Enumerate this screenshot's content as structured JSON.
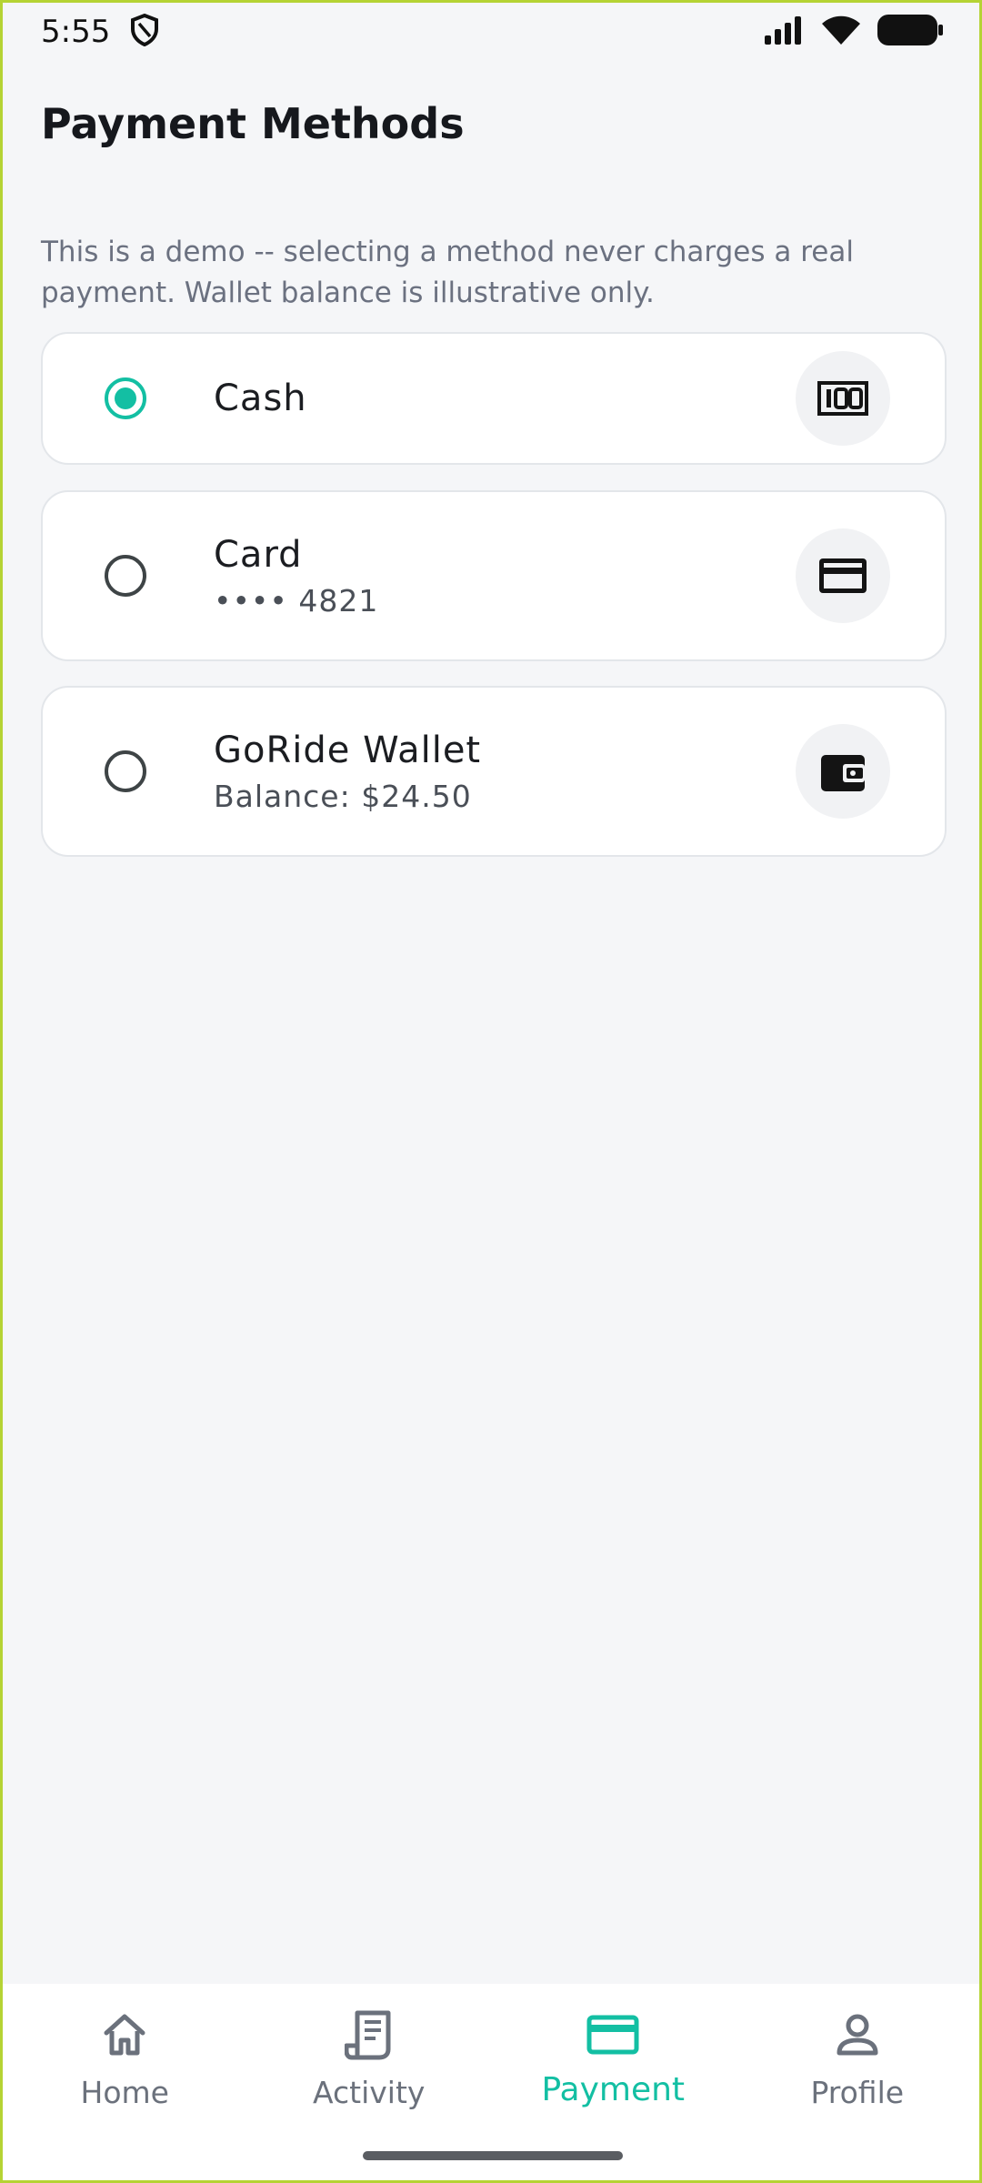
{
  "status_bar": {
    "time": "5:55",
    "left_icon": "shield-icon",
    "right_icons": [
      "signal-icon",
      "wifi-icon",
      "battery-icon"
    ]
  },
  "page": {
    "title": "Payment Methods",
    "disclaimer": "This is a demo -- selecting a method never charges a real payment. Wallet balance is illustrative only."
  },
  "methods": [
    {
      "label": "Cash",
      "sub": "",
      "selected": true,
      "icon": "cash-icon"
    },
    {
      "label": "Card",
      "sub": "•••• 4821",
      "selected": false,
      "icon": "credit-card-icon"
    },
    {
      "label": "GoRide Wallet",
      "sub": "Balance: $24.50",
      "selected": false,
      "icon": "wallet-icon"
    }
  ],
  "nav": {
    "items": [
      {
        "label": "Home",
        "icon": "home-icon",
        "active": false
      },
      {
        "label": "Activity",
        "icon": "receipt-icon",
        "active": false
      },
      {
        "label": "Payment",
        "icon": "credit-card-icon",
        "active": true
      },
      {
        "label": "Profile",
        "icon": "person-icon",
        "active": false
      }
    ]
  },
  "colors": {
    "accent": "#13bfa3",
    "background": "#f5f6f8",
    "text_secondary": "#6b7180"
  }
}
